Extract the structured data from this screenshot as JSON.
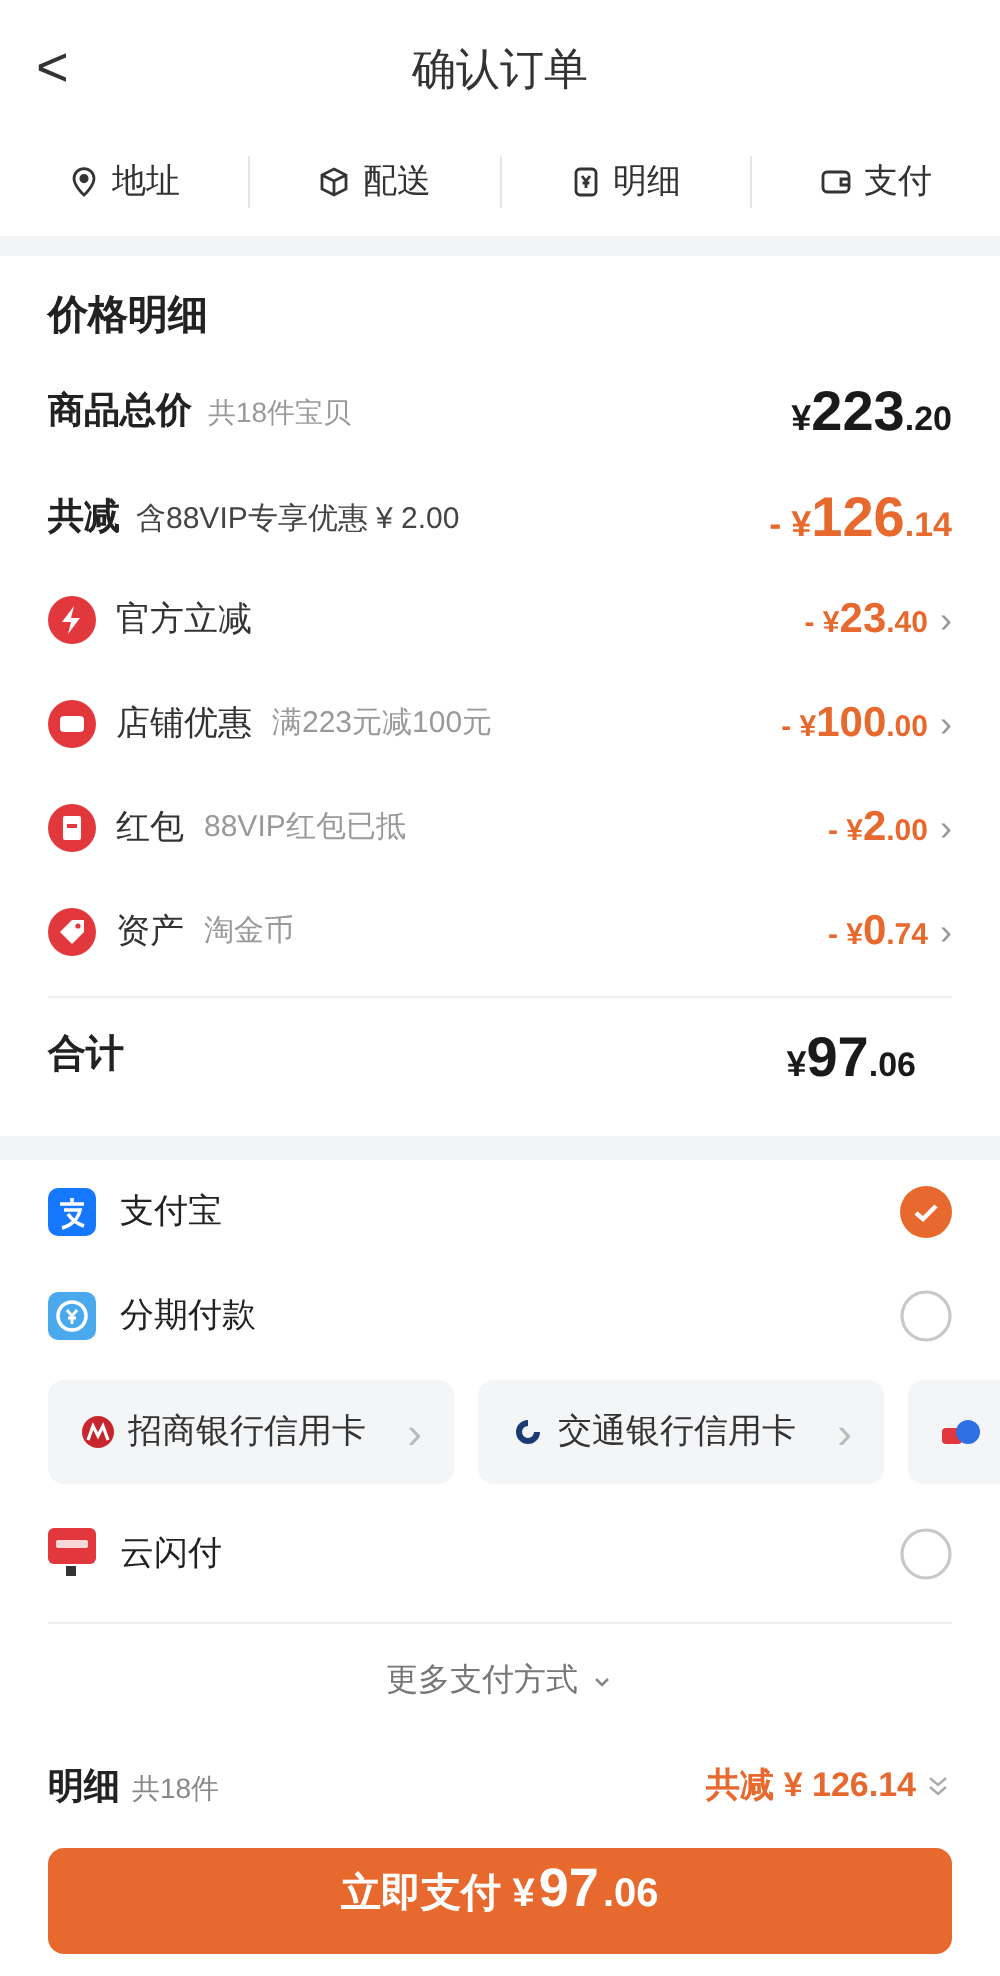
{
  "header": {
    "back": "<",
    "title": "确认订单"
  },
  "steps": [
    {
      "kind": "pin",
      "label": "地址"
    },
    {
      "kind": "box",
      "label": "配送"
    },
    {
      "kind": "yen",
      "label": "明细"
    },
    {
      "kind": "wallet",
      "label": "支付"
    }
  ],
  "price_detail": {
    "title": "价格明细",
    "total": {
      "label": "商品总价",
      "note": "共18件宝贝",
      "prefix": "¥",
      "int": "223",
      "dec": ".20"
    },
    "discount": {
      "label": "共减",
      "note": "含88VIP专享优惠 ¥ 2.00",
      "prefix": "- ¥",
      "int": "126",
      "dec": ".14"
    },
    "items": [
      {
        "kind": "bolt",
        "label": "官方立减",
        "prefix": "- ¥",
        "int": "23",
        "dec": ".40",
        "arrow": "›"
      },
      {
        "kind": "shop",
        "label": "店铺优惠",
        "note": "满223元减100元",
        "prefix": "- ¥",
        "int": "100",
        "dec": ".00",
        "arrow": "›"
      },
      {
        "kind": "packet",
        "label": "红包",
        "note": "88VIP红包已抵",
        "prefix": "- ¥",
        "int": "2",
        "dec": ".00",
        "arrow": "›"
      },
      {
        "kind": "tag",
        "label": "资产",
        "note": "淘金币",
        "prefix": "- ¥",
        "int": "0",
        "dec": ".74",
        "arrow": "›"
      }
    ],
    "sum": {
      "label": "合计",
      "prefix": "¥",
      "int": "97",
      "dec": ".06"
    }
  },
  "payment": {
    "methods": [
      {
        "kind": "alipay",
        "label": "支付宝",
        "selected": true
      },
      {
        "kind": "installment",
        "label": "分期付款",
        "selected": false
      }
    ],
    "cards": [
      {
        "kind": "cmb",
        "label": "招商银行信用卡",
        "arrow": "›"
      },
      {
        "kind": "bocom",
        "label": "交通银行信用卡",
        "arrow": "›"
      },
      {
        "kind": "huabei"
      }
    ],
    "extra": [
      {
        "kind": "unionpay",
        "label": "云闪付",
        "selected": false
      }
    ],
    "more": "更多支付方式"
  },
  "footer": {
    "label": "明细",
    "count": "共18件",
    "saving": "共减 ¥ 126.14",
    "pay_label": "立即支付 ¥",
    "pay_int": "97",
    "pay_dec": ".06"
  }
}
